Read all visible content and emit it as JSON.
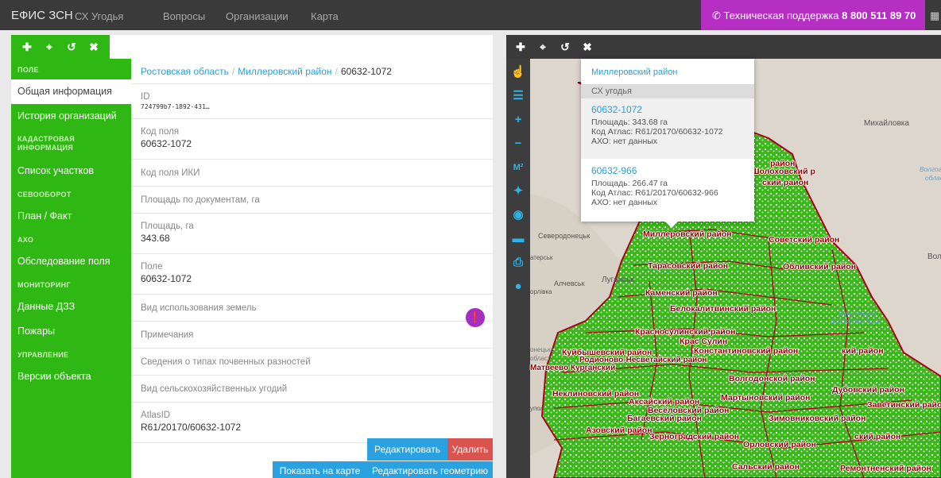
{
  "topbar": {
    "brand": "ЕФИС ЗСН",
    "nav": [
      "СХ Угодья",
      "Вопросы",
      "Организации",
      "Карта"
    ],
    "support_label": "Техническая поддержка",
    "support_phone": "8 800 511 89 70",
    "support_icon": "phone-icon",
    "grid_icon": "grid-icon"
  },
  "left_toolbar": {
    "icons": [
      "move-icon",
      "expand-icon",
      "popout-icon",
      "close-icon"
    ]
  },
  "sidebar": {
    "items": [
      {
        "type": "section",
        "label": "ПОЛЕ"
      },
      {
        "type": "item",
        "label": "Общая информация",
        "active": true
      },
      {
        "type": "item",
        "label": "История организаций"
      },
      {
        "type": "section",
        "label": "КАДАСТРОВАЯ ИНФОРМАЦИЯ"
      },
      {
        "type": "item",
        "label": "Список участков"
      },
      {
        "type": "section",
        "label": "СЕВООБОРОТ"
      },
      {
        "type": "item",
        "label": "План / Факт"
      },
      {
        "type": "section",
        "label": "АХО"
      },
      {
        "type": "item",
        "label": "Обследование поля"
      },
      {
        "type": "section",
        "label": "МОНИТОРИНГ"
      },
      {
        "type": "item",
        "label": "Данные ДЗЗ"
      },
      {
        "type": "item",
        "label": "Пожары"
      },
      {
        "type": "section",
        "label": "УПРАВЛЕНИЕ"
      },
      {
        "type": "item",
        "label": "Версии объекта"
      }
    ]
  },
  "breadcrumb": {
    "region": "Ростовская область",
    "district": "Миллеровский район",
    "current": "60632-1072",
    "sep": "/"
  },
  "fields": {
    "id": {
      "label": "ID",
      "value": "724799b7-1892-431…"
    },
    "code": {
      "label": "Код поля",
      "value": "60632-1072"
    },
    "iki_code": {
      "label": "Код поля ИКИ"
    },
    "doc_area": {
      "label": "Площадь по документам, га"
    },
    "area": {
      "label": "Площадь, га",
      "value": "343.68"
    },
    "field": {
      "label": "Поле",
      "value": "60632-1072"
    },
    "land_use": {
      "label": "Вид использования земель"
    },
    "notes": {
      "label": "Примечания"
    },
    "soil": {
      "label": "Сведения о типах почвенных разностей"
    },
    "land_type": {
      "label": "Вид сельскохозяйственных угодий"
    },
    "atlas": {
      "label": "AtlasID",
      "value": "R61/20170/60632-1072"
    }
  },
  "buttons": {
    "edit": "Редактировать",
    "delete": "Удалить",
    "show_on_map": "Показать на карте",
    "edit_geometry": "Редактировать геометрию"
  },
  "help_icon": "info-icon",
  "map_toolbar": {
    "icons": [
      "move-icon",
      "expand-icon",
      "popout-icon",
      "close-icon"
    ]
  },
  "map_tools": [
    "cursor-icon",
    "layers-icon",
    "zoom-in-icon",
    "zoom-out-icon",
    "area-measure-icon",
    "locate-icon",
    "eye-icon",
    "folder-icon",
    "print-icon",
    "globe-icon"
  ],
  "map_tool_glyphs": {
    "area": "M²",
    "zoom_in": "+",
    "zoom_out": "−"
  },
  "map": {
    "places": [
      "Михайловка",
      "Волгоградс-",
      "област",
      "Северодонецьк",
      "Алчевськ",
      "Луганськ",
      "Вол",
      "орлівка",
      "Матвеево Курганский",
      "Цимлянское",
      "водохранилище",
      "атерськ",
      "онецька",
      "область",
      "упол"
    ],
    "districts": [
      "Миллеровский район",
      "Советский район",
      "Тарасовский район",
      "Обливский район",
      "Каменский район",
      "Белокалитвинский район",
      "Красносулинский район",
      "Куйбышевский район",
      "Родионово-Несветайский район",
      "Константиновский район",
      "Неклиновский район",
      "Мартыновский район",
      "Азовский район",
      "Зерноградский район",
      "Орловский район",
      "Сальский район",
      "Ремонтненский район",
      "Зимовниковский район",
      "Заветинский район",
      "Дубовский район",
      "Волгодонской район",
      "Шолоховский р",
      "Весёловский район",
      "Багаевский район",
      "Аксайский район",
      "Крас Сулин",
      "кий район",
      "район",
      "ский район",
      "ский раион"
    ]
  },
  "popup": {
    "district": "Миллеровский район",
    "category": "СХ угодья",
    "entries": [
      {
        "code": "60632-1072",
        "area": "Площадь: 343.68 га",
        "atlas": "Код Атлас: R61/20170/60632-1072",
        "aho": "АХО: нет данных"
      },
      {
        "code": "60632-966",
        "area": "Площадь: 266.47 га",
        "atlas": "Код Атлас: R61/20170/60632-966",
        "aho": "АХО: нет данных"
      }
    ]
  },
  "colors": {
    "green": "#2fb713",
    "purple": "#b52fc2",
    "blue": "#2aa1e0",
    "red": "#d9534f",
    "border_red": "#b0001a"
  }
}
